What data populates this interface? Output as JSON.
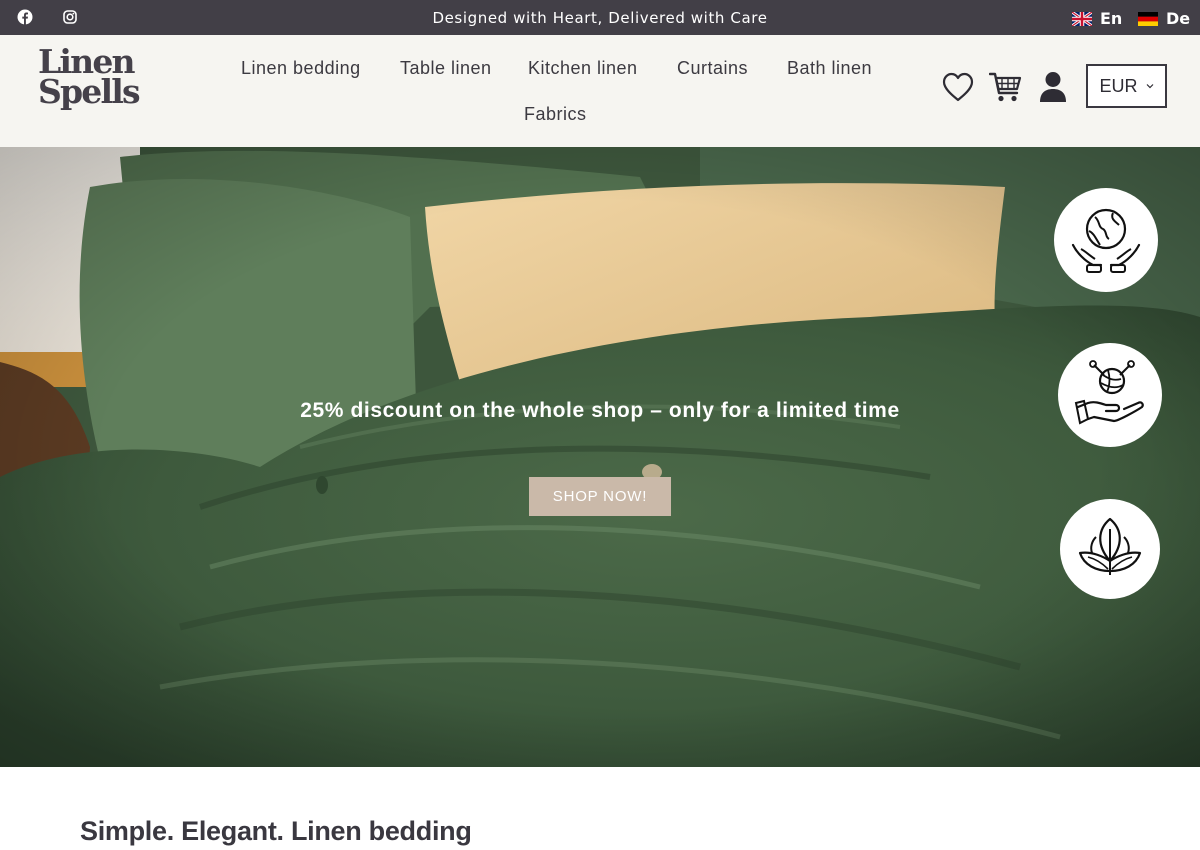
{
  "topbar": {
    "tagline": "Designed with Heart, Delivered with Care",
    "social": [
      {
        "icon": "facebook-icon"
      },
      {
        "icon": "instagram-icon"
      }
    ],
    "languages": [
      {
        "code": "En",
        "flag": "uk-flag-icon"
      },
      {
        "code": "De",
        "flag": "germany-flag-icon"
      }
    ],
    "background_color": "#423f47"
  },
  "header": {
    "logo": {
      "line1": "Linen",
      "line2": "Spells"
    },
    "nav": [
      {
        "label": "Linen bedding"
      },
      {
        "label": "Table linen"
      },
      {
        "label": "Kitchen linen"
      },
      {
        "label": "Curtains"
      },
      {
        "label": "Bath linen"
      },
      {
        "label": "Fabrics"
      }
    ],
    "icons": [
      "heart-icon",
      "cart-icon",
      "user-icon"
    ],
    "currency": "EUR",
    "background_color": "#f6f5f1"
  },
  "hero": {
    "headline": "25% discount on the whole shop – only for a limited time",
    "cta_label": "SHOP NOW!",
    "cta_color": "#cab9a9",
    "badges": [
      {
        "icon": "globe-hands-icon"
      },
      {
        "icon": "yarn-hand-icon"
      },
      {
        "icon": "leaf-icon"
      }
    ]
  },
  "section": {
    "title": "Simple. Elegant. Linen bedding"
  }
}
